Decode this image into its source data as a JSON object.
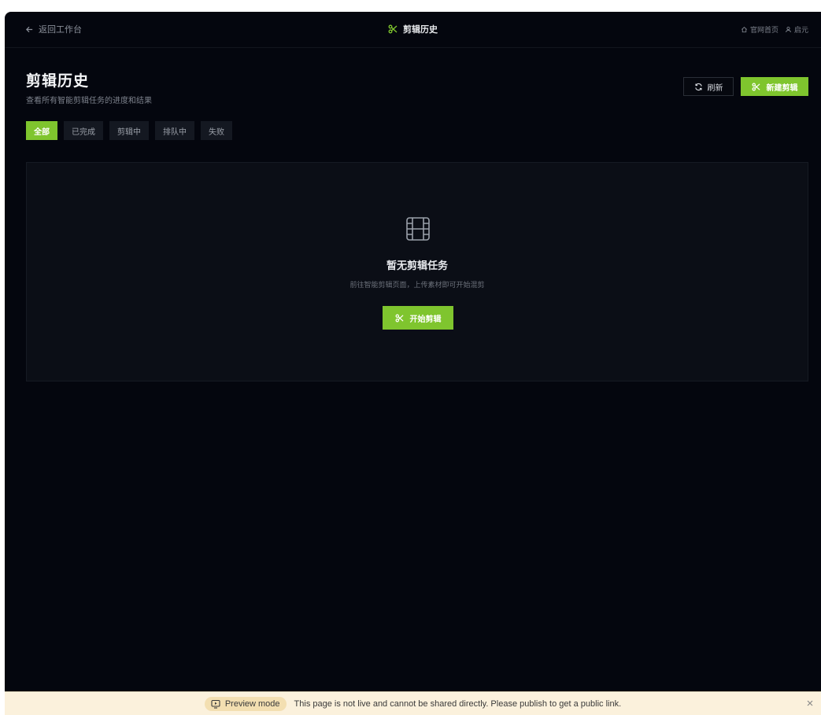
{
  "topbar": {
    "back_label": "返回工作台",
    "title": "剪辑历史",
    "links": [
      {
        "label": "官网首页",
        "icon": "home-icon"
      },
      {
        "label": "启元",
        "icon": "user-icon"
      }
    ]
  },
  "header": {
    "title": "剪辑历史",
    "subtitle": "查看所有智能剪辑任务的进度和结果",
    "refresh_label": "刷新",
    "new_label": "新建剪辑"
  },
  "tabs": [
    {
      "label": "全部",
      "active": true
    },
    {
      "label": "已完成",
      "active": false
    },
    {
      "label": "剪辑中",
      "active": false
    },
    {
      "label": "排队中",
      "active": false
    },
    {
      "label": "失败",
      "active": false
    }
  ],
  "empty_state": {
    "icon": "film-icon",
    "title": "暂无剪辑任务",
    "description": "前往智能剪辑页面，上传素材即可开始混剪",
    "button_label": "开始剪辑"
  },
  "banner": {
    "mode_label": "Preview mode",
    "message": "This page is not live and cannot be shared directly. Please publish to get a public link."
  },
  "colors": {
    "background": "#04060e",
    "accent": "#7fc52e",
    "card": "#0b0e16",
    "banner": "#fbf1dc"
  }
}
